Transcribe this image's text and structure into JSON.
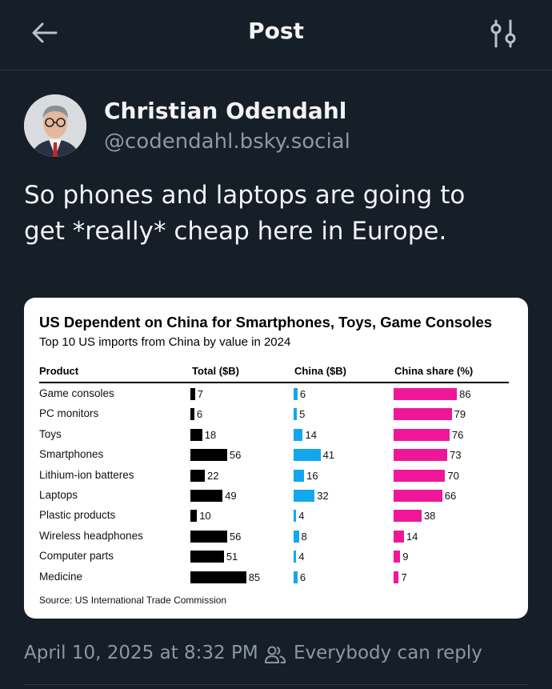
{
  "header": {
    "title": "Post",
    "back_icon": "arrow-left-icon",
    "filter_icon": "sliders-icon"
  },
  "post": {
    "author_name": "Christian Odendahl",
    "author_handle": "@codendahl.bsky.social",
    "text_line1": "So phones and laptops are going to",
    "text_line2": "get *really* cheap here in Europe.",
    "timestamp": "April 10, 2025 at 8:32 PM",
    "reply_setting": "Everybody can reply",
    "reply_icon": "people-icon"
  },
  "colors": {
    "background": "#161e27",
    "text_primary": "#f1f3f5",
    "text_muted": "#8b98a8",
    "accent_blue": "#1da1f2",
    "total_bar": "#000000",
    "china_bar": "#12a7ef",
    "share_bar": "#f0169a"
  },
  "chart_data": {
    "type": "table",
    "title": "US Dependent on China for Smartphones, Toys, Game Consoles",
    "subtitle": "Top 10 US imports from China by value in 2024",
    "columns": [
      "Product",
      "Total ($B)",
      "China ($B)",
      "China share (%)"
    ],
    "categories": [
      "Game consoles",
      "PC monitors",
      "Toys",
      "Smartphones",
      "Lithium-ion batteres",
      "Laptops",
      "Plastic products",
      "Wireless headphones",
      "Computer parts",
      "Medicine"
    ],
    "series": [
      {
        "name": "Total ($B)",
        "values": [
          7,
          6,
          18,
          56,
          22,
          49,
          10,
          56,
          51,
          85
        ]
      },
      {
        "name": "China ($B)",
        "values": [
          6,
          5,
          14,
          41,
          16,
          32,
          4,
          8,
          4,
          6
        ]
      },
      {
        "name": "China share (%)",
        "values": [
          86,
          79,
          76,
          73,
          70,
          66,
          38,
          14,
          9,
          7
        ]
      }
    ],
    "source": "Source: US International Trade Commission"
  }
}
